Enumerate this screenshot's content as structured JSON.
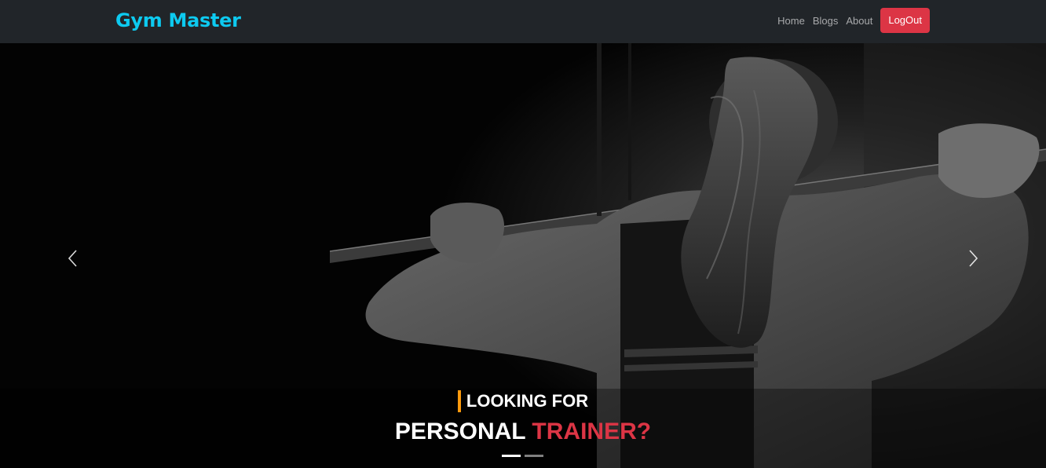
{
  "navbar": {
    "brand": "Gym Master",
    "links": [
      "Home",
      "Blogs",
      "About"
    ],
    "logout_label": "LogOut"
  },
  "carousel": {
    "caption_top": "LOOKING FOR",
    "caption_main_white": "PERSONAL",
    "caption_main_accent": "TRAINER?",
    "prev_icon": "chevron-left-icon",
    "next_icon": "chevron-right-icon",
    "slide_count": 2,
    "active_slide": 1
  },
  "colors": {
    "navbar_bg": "#212529",
    "brand": "#0dcaf0",
    "logout_bg": "#dc3545",
    "caption_accent": "#dc3545",
    "caption_bar": "#fd9a0d"
  }
}
